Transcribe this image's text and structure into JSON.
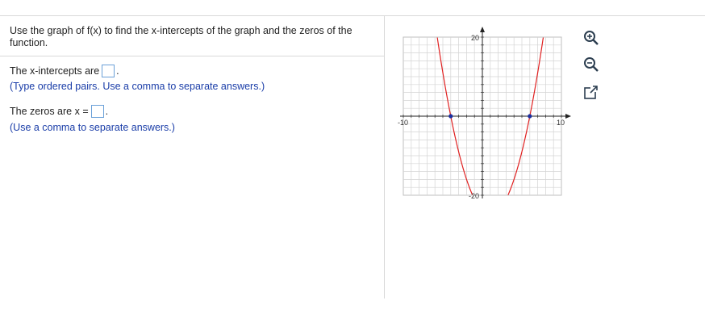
{
  "question": {
    "text": "Use the graph of f(x) to find the x-intercepts of the graph and the zeros of the function."
  },
  "part1": {
    "label": "The x-intercepts are",
    "hint": "(Type ordered pairs. Use a comma to separate answers.)"
  },
  "part2": {
    "label": "The zeros are x =",
    "hint": "(Use a comma to separate answers.)"
  },
  "graph": {
    "tick_labels": {
      "x_min": "-10",
      "x_max": "10",
      "y_max": "20",
      "y_min": "-20"
    },
    "points": [
      {
        "x": -4,
        "y": 0
      },
      {
        "x": 6,
        "y": 0
      }
    ],
    "curve": {
      "type": "quadratic",
      "a": 1,
      "b": -2,
      "c": -24
    },
    "xlim": [
      -10,
      10
    ],
    "ylim": [
      -20,
      20
    ],
    "grid": true,
    "curve_color": "#e02020",
    "point_color": "#1c2fa0"
  },
  "tools": [
    {
      "icon": "zoom-in-icon"
    },
    {
      "icon": "zoom-out-icon"
    },
    {
      "icon": "expand-icon"
    }
  ]
}
